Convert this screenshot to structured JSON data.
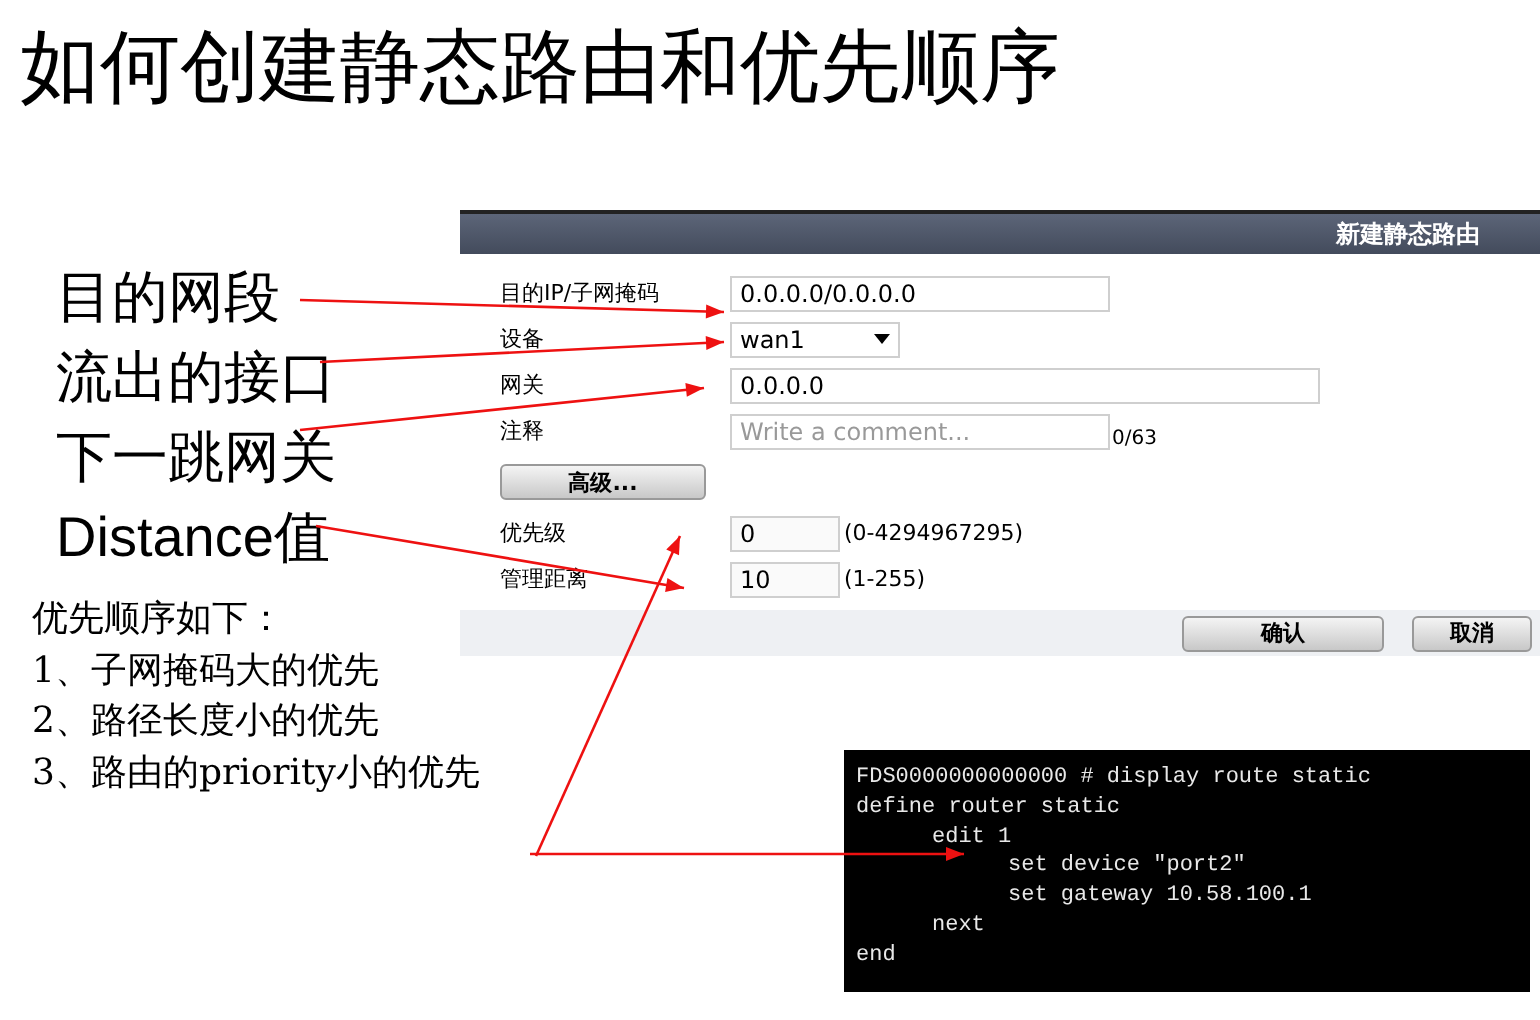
{
  "title": "如何创建静态路由和优先顺序",
  "callouts": [
    "目的网段",
    "流出的接口",
    "下一跳网关",
    "Distance值"
  ],
  "priority_note": {
    "heading": "优先顺序如下：",
    "items": [
      "1、子网掩码大的优先",
      "2、路径长度小的优先",
      "3、路由的priority小的优先"
    ]
  },
  "dialog": {
    "title": "新建静态路由",
    "fields": [
      {
        "kind": "text",
        "label": "目的IP/子网掩码",
        "value": "0.0.0.0/0.0.0.0"
      },
      {
        "kind": "select",
        "label": "设备",
        "value": "wan1"
      },
      {
        "kind": "text",
        "label": "网关",
        "value": "0.0.0.0"
      },
      {
        "kind": "comment",
        "label": "注释",
        "placeholder": "Write a comment...",
        "counter": "0/63"
      }
    ],
    "advanced_button": "高级...",
    "advanced_fields": [
      {
        "label": "优先级",
        "value": "0",
        "range": "(0-4294967295)"
      },
      {
        "label": "管理距离",
        "value": "10",
        "range": "(1-255)"
      }
    ],
    "buttons": [
      "确认",
      "取消"
    ]
  },
  "terminal": {
    "lines": [
      {
        "text": "FDS0000000000000 # display route static"
      },
      {
        "text": "define router static",
        "children": [
          {
            "text": "edit 1",
            "children": [
              {
                "text": "set device \"port2\""
              },
              {
                "text": "set gateway 10.58.100.1"
              }
            ]
          },
          {
            "text": "next"
          }
        ]
      },
      {
        "text": "end"
      }
    ]
  }
}
